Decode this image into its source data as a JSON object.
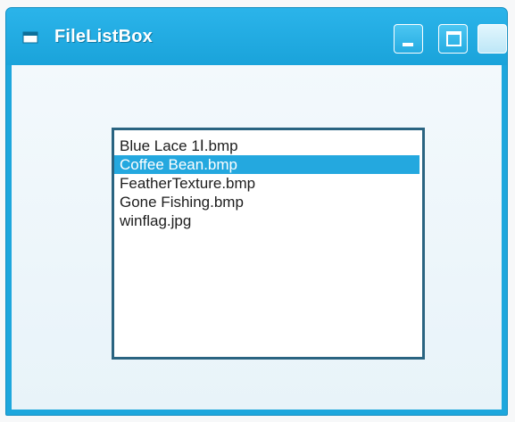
{
  "window": {
    "title": "FileListBox",
    "icon": "app-window-icon",
    "controls": [
      "minimize-icon",
      "maximize-icon",
      "close-icon"
    ]
  },
  "listbox": {
    "items": [
      {
        "label": "Blue Lace 1Ⅰ.bmp",
        "selected": false
      },
      {
        "label": "Coffee Bean.bmp",
        "selected": true
      },
      {
        "label": "FeatherTexture.bmp",
        "selected": false
      },
      {
        "label": "Gone Fishing.bmp",
        "selected": false
      },
      {
        "label": "winflag.jpg",
        "selected": false
      }
    ]
  },
  "colors": {
    "title_bar": "#1ea7dd",
    "selection": "#24a8df",
    "listbox_border": "#2a6481"
  }
}
